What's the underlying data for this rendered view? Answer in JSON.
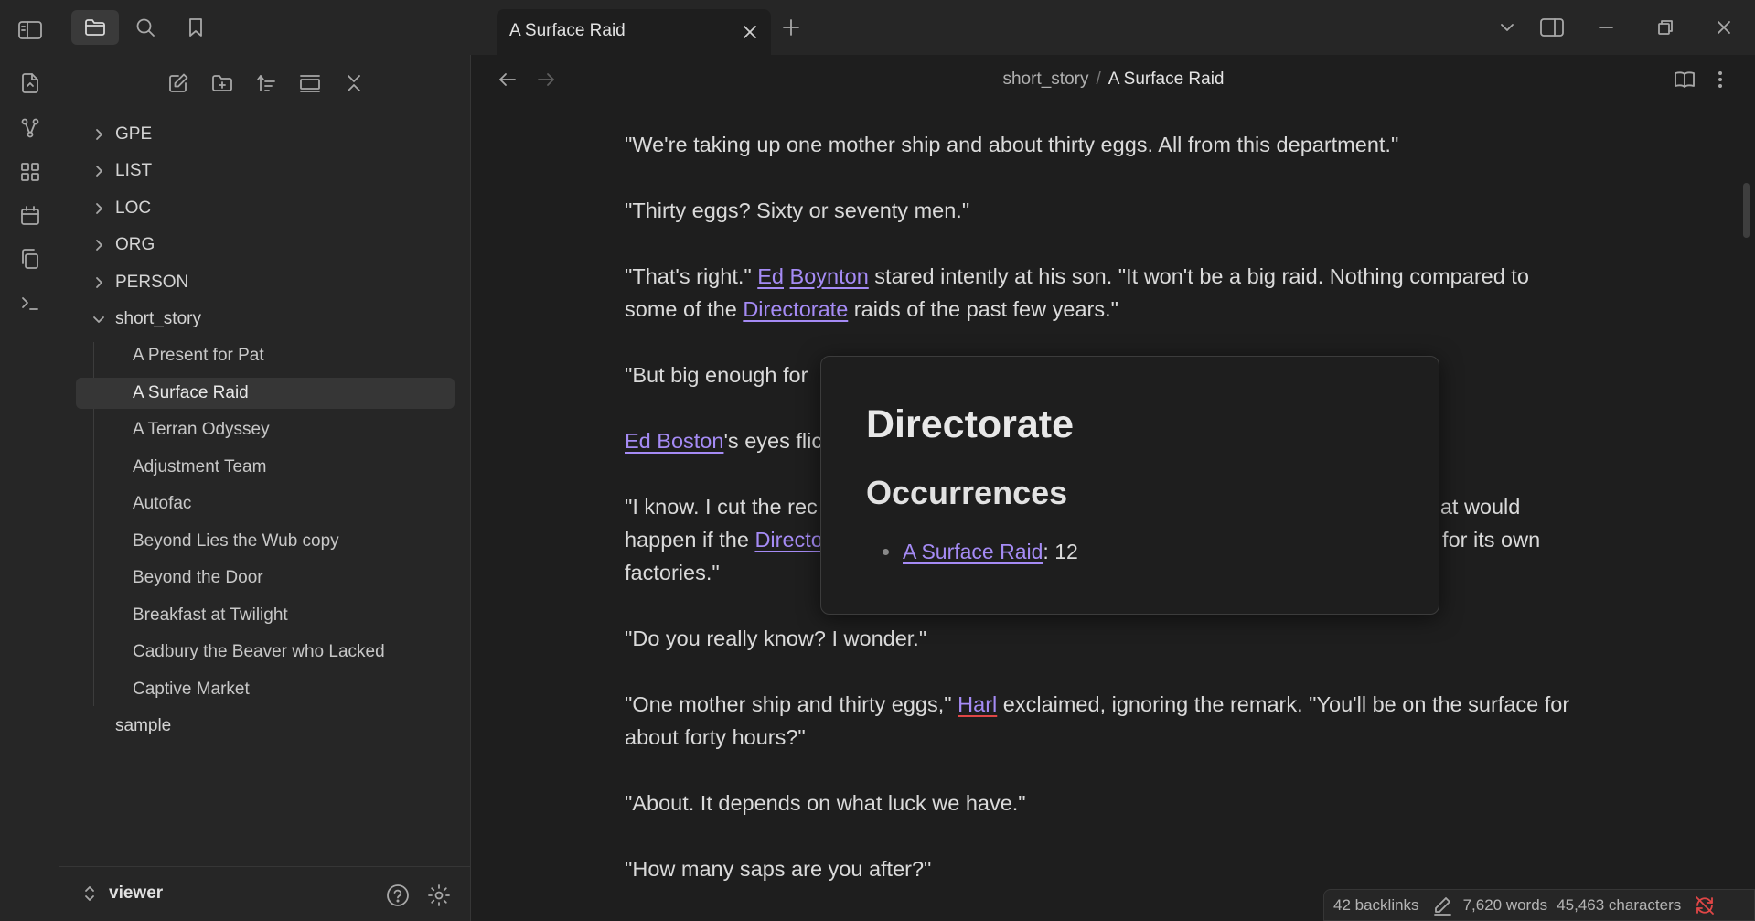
{
  "tabs": [
    {
      "title": "A Surface Raid"
    }
  ],
  "breadcrumb": {
    "folder": "short_story",
    "current": "A Surface Raid"
  },
  "sidebar": {
    "folders_top": [
      "GPE",
      "LIST",
      "LOC",
      "ORG",
      "PERSON"
    ],
    "open_folder": "short_story",
    "files": [
      "A Present for Pat",
      "A Surface Raid",
      "A Terran Odyssey",
      "Adjustment Team",
      "Autofac",
      "Beyond Lies the Wub copy",
      "Beyond the Door",
      "Breakfast at Twilight",
      "Cadbury the Beaver who Lacked",
      "Captive Market"
    ],
    "active_file": "A Surface Raid",
    "root_file": "sample",
    "vault_name": "viewer"
  },
  "content": {
    "p1": "\"We're taking up one mother ship and about thirty eggs. All from this department.\"",
    "p2": "\"Thirty eggs? Sixty or seventy men.\"",
    "p3a": "\"That's right.\" ",
    "p3_link1": "Ed",
    "p3_link2": "Boynton",
    "p3b": " stared intently at his son. \"It won't be a big raid. Nothing compared to some of the ",
    "p3_link3": "Directorate",
    "p3c": " raids of the past few years.\"",
    "p4": "\"But big enough for",
    "p5_link": "Ed Boston",
    "p5": "'s eyes flic",
    "p6a": "\"I know. I cut the rec",
    "p6b": "at would",
    "p6c": "happen if the ",
    "p6_link": "Directo",
    "p6d": "-- for its own",
    "p6e": "factories.\"",
    "p7": "\"Do you really know? I wonder.\"",
    "p8a": "\"One mother ship and thirty eggs,\" ",
    "p8_link": "Harl",
    "p8b": " exclaimed, ignoring the remark. \"You'll be on the surface for about forty hours?\"",
    "p9": "\"About. It depends on what luck we have.\"",
    "p10": "\"How many saps are you after?\""
  },
  "popover": {
    "title": "Directorate",
    "subtitle": "Occurrences",
    "item_link": "A Surface Raid",
    "item_suffix": ": 12"
  },
  "status": {
    "backlinks": "42 backlinks",
    "words": "7,620 words",
    "characters": "45,463 characters"
  },
  "colors": {
    "background": "#1e1e1e",
    "panel": "#262626",
    "link": "#a58bf5",
    "sync_error": "#e04646"
  }
}
